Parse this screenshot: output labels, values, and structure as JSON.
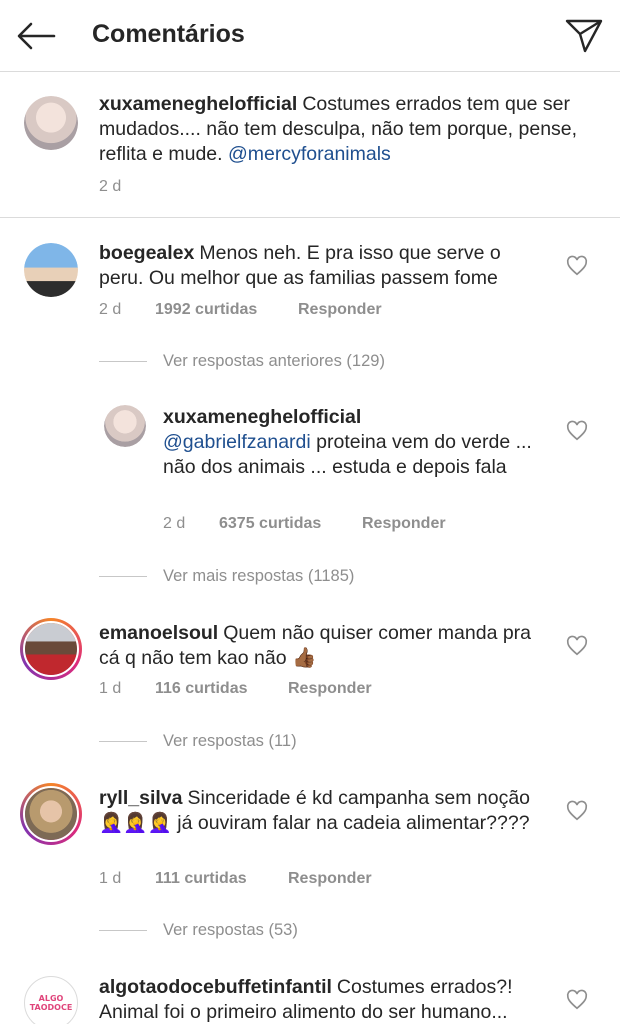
{
  "header": {
    "title": "Comentários",
    "back_icon": "arrow-left-icon",
    "share_icon": "paper-plane-icon"
  },
  "caption": {
    "username": "xuxameneghelofficial",
    "text": "Costumes errados tem que ser mudados.... não tem desculpa, não tem porque, pense, reflita e mude.",
    "mention": "@mercyforanimals",
    "time": "2 d"
  },
  "comments": [
    {
      "username": "boegealex",
      "text": "Menos neh. E pra isso que serve o peru. Ou melhor que as familias passem fome",
      "time": "2 d",
      "likes": "1992 curtidas",
      "reply": "Responder",
      "thread": "Ver respostas anteriores (129)"
    },
    {
      "username": "xuxameneghelofficial",
      "mention": "@gabrielfzanardi",
      "text": "proteina vem do verde ... não dos animais ... estuda e depois fala",
      "time": "2 d",
      "likes": "6375 curtidas",
      "reply": "Responder",
      "thread": "Ver mais respostas (1185)"
    },
    {
      "username": "emanoelsoul",
      "text": "Quem não quiser comer manda pra cá q não tem kao não 👍🏾",
      "time": "1 d",
      "likes": "116 curtidas",
      "reply": "Responder",
      "thread": "Ver respostas (11)"
    },
    {
      "username": "ryll_silva",
      "text": "Sinceridade é kd campanha sem noção 🤦‍♀️🤦‍♀️🤦‍♀️ já ouviram falar na cadeia alimentar????",
      "time": "1 d",
      "likes": "111 curtidas",
      "reply": "Responder",
      "thread": "Ver respostas (53)"
    },
    {
      "username": "algotaodocebuffetinfantil",
      "text": "Costumes errados?! Animal foi o primeiro alimento do ser humano...",
      "avatar_label": "ALGO TAODOCE"
    }
  ],
  "colors": {
    "mention": "#1f4f8f",
    "muted": "#8e8e8e",
    "text": "#262626",
    "divider": "#dbdbdb"
  }
}
